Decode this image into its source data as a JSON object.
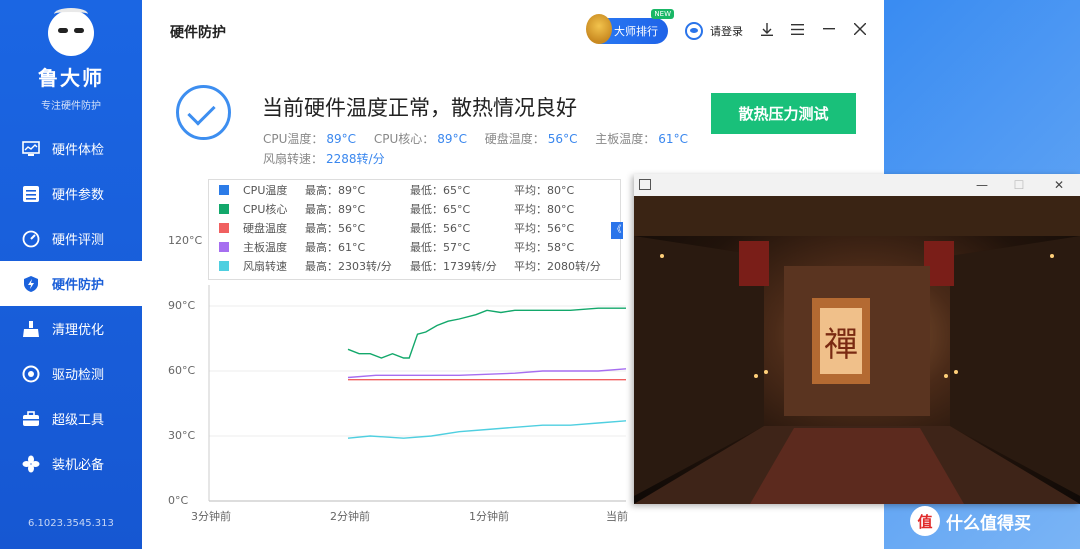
{
  "sidebar": {
    "brand": "鲁大师",
    "subtitle": "专注硬件防护",
    "version": "6.1023.3545.313",
    "items": [
      {
        "label": "硬件体检",
        "icon": "monitor-chart-icon"
      },
      {
        "label": "硬件参数",
        "icon": "sliders-icon"
      },
      {
        "label": "硬件评测",
        "icon": "gauge-icon"
      },
      {
        "label": "硬件防护",
        "icon": "shield-bolt-icon",
        "active": true
      },
      {
        "label": "清理优化",
        "icon": "broom-icon"
      },
      {
        "label": "驱动检测",
        "icon": "driver-icon"
      },
      {
        "label": "超级工具",
        "icon": "toolbox-icon"
      },
      {
        "label": "装机必备",
        "icon": "fan-icon"
      }
    ]
  },
  "header": {
    "title": "硬件防护",
    "rank_label": "大师排行",
    "rank_badge": "NEW",
    "login_label": "请登录"
  },
  "status": {
    "title": "当前硬件温度正常，散热情况良好",
    "metrics": [
      {
        "label": "CPU温度：",
        "value": "89°C"
      },
      {
        "label": "CPU核心：",
        "value": "89°C"
      },
      {
        "label": "硬盘温度：",
        "value": "56°C"
      },
      {
        "label": "主板温度：",
        "value": "61°C"
      }
    ],
    "fan_label": "风扇转速：",
    "fan_value": "2288转/分",
    "button_label": "散热压力测试"
  },
  "legend": [
    {
      "name": "CPU温度",
      "max": "最高：89°C",
      "min": "最低：65°C",
      "avg": "平均：80°C",
      "color": "#2c7ce8"
    },
    {
      "name": "CPU核心",
      "max": "最高：89°C",
      "min": "最低：65°C",
      "avg": "平均：80°C",
      "color": "#13a86b"
    },
    {
      "name": "硬盘温度",
      "max": "最高：56°C",
      "min": "最低：56°C",
      "avg": "平均：56°C",
      "color": "#f06060"
    },
    {
      "name": "主板温度",
      "max": "最高：61°C",
      "min": "最低：57°C",
      "avg": "平均：58°C",
      "color": "#a66ef0"
    },
    {
      "name": "风扇转速",
      "max": "最高：2303转/分",
      "min": "最低：1739转/分",
      "avg": "平均：2080转/分",
      "color": "#4fcfe0"
    }
  ],
  "collapse_glyph": "《",
  "chart_data": {
    "type": "line",
    "y_ticks": [
      "120°C",
      "90°C",
      "60°C",
      "30°C",
      "0°C"
    ],
    "x_ticks": [
      "3分钟前",
      "2分钟前",
      "1分钟前",
      "当前"
    ],
    "ylim": [
      0,
      120
    ],
    "series": [
      {
        "name": "CPU核心",
        "color": "#13a86b",
        "x": [
          0.0,
          0.04,
          0.08,
          0.12,
          0.16,
          0.2,
          0.22,
          0.25,
          0.28,
          0.32,
          0.36,
          0.4,
          0.46,
          0.5,
          0.55,
          0.6,
          0.7,
          0.8,
          0.9,
          1.0
        ],
        "values": [
          70,
          68,
          68,
          66,
          68,
          66,
          66,
          77,
          78,
          81,
          83,
          84,
          86,
          88,
          87,
          88,
          88,
          88,
          89,
          89
        ]
      },
      {
        "name": "主板温度",
        "color": "#a66ef0",
        "x": [
          0.0,
          0.1,
          0.2,
          0.4,
          0.6,
          0.7,
          0.9,
          1.0
        ],
        "values": [
          57,
          58,
          58,
          58,
          59,
          60,
          60,
          61
        ]
      },
      {
        "name": "硬盘温度",
        "color": "#f06060",
        "x": [
          0.0,
          1.0
        ],
        "values": [
          56,
          56
        ]
      },
      {
        "name": "风扇转速",
        "color": "#4fcfe0",
        "x": [
          0.0,
          0.08,
          0.2,
          0.3,
          0.4,
          0.5,
          0.6,
          0.7,
          0.8,
          0.9,
          1.0
        ],
        "values": [
          29,
          30,
          29,
          30,
          32,
          33,
          34,
          35,
          35,
          36,
          37
        ]
      }
    ]
  },
  "overlay": {
    "minimize": "—",
    "maximize": "☐",
    "close": "✕",
    "scene_char": "禪"
  },
  "brand_watermark": {
    "icon": "值",
    "text": "什么值得买"
  },
  "ui_colors": {
    "accent": "#2a74ea",
    "success": "#19c07a"
  }
}
